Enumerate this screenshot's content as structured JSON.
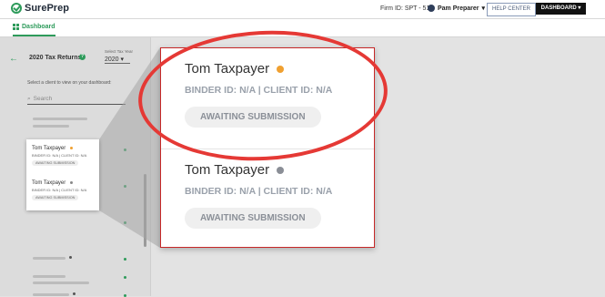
{
  "header": {
    "logo_text": "SurePrep",
    "firm_id_label": "Firm ID:",
    "firm_id_value": "SPT - 51",
    "user_name": "Pam Preparer",
    "user_caret": "▾",
    "help_center": "HELP CENTER",
    "dashboard_button": "DASHBOARD ▾"
  },
  "subnav": {
    "tab_label": "Dashboard"
  },
  "sidebar": {
    "back_icon": "←",
    "title": "2020 Tax Returns",
    "help_icon": "?",
    "year_label": "Select Tax Year",
    "year_value": "2020",
    "year_caret": "▾",
    "select_hint": "Select a client to view on your dashboard:",
    "search_placeholder": "Search"
  },
  "mini_card": {
    "clients": [
      {
        "name": "Tom Taxpayer",
        "meta": "BINDER ID: N/A | CLIENT ID: N/A",
        "status": "AWAITING SUBMISSION",
        "dot_color": "#f0a030"
      },
      {
        "name": "Tom Taxpayer",
        "meta": "BINDER ID: N/A | CLIENT ID: N/A",
        "status": "AWAITING SUBMISSION",
        "dot_color": "#888888"
      }
    ]
  },
  "zoom_card": {
    "clients": [
      {
        "name": "Tom Taxpayer",
        "meta": "BINDER ID: N/A | CLIENT ID: N/A",
        "status": "AWAITING SUBMISSION",
        "dot_color": "#f0a030"
      },
      {
        "name": "Tom Taxpayer",
        "meta": "BINDER ID: N/A | CLIENT ID: N/A",
        "status": "AWAITING SUBMISSION",
        "dot_color": "#8a8e96"
      }
    ]
  },
  "colors": {
    "accent": "#2e9b5b",
    "highlight_ring": "#e53935"
  }
}
